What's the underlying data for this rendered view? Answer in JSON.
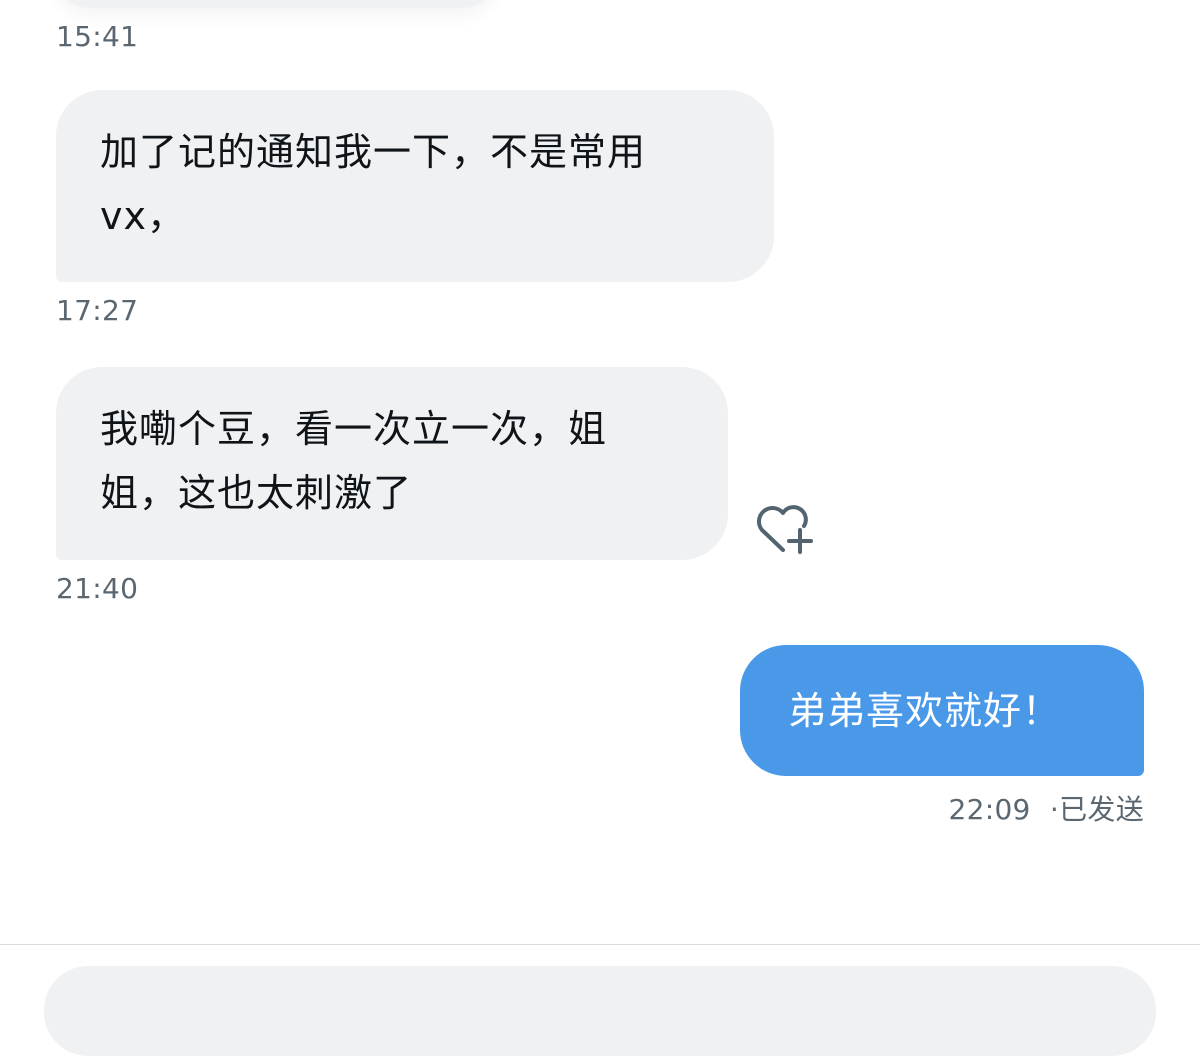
{
  "conversation": {
    "messages": [
      {
        "direction": "incoming",
        "time": "15:41"
      },
      {
        "direction": "incoming",
        "lines": [
          "加了记的通知我一下，不是常用",
          "vx，"
        ],
        "time": "17:27"
      },
      {
        "direction": "incoming",
        "lines": [
          "我嘞个豆，看一次立一次，姐",
          "姐，这也太刺激了"
        ],
        "time": "21:40",
        "reaction_icon": "heart-plus-icon"
      },
      {
        "direction": "outgoing",
        "text": "弟弟喜欢就好！",
        "time": "22:09",
        "status": "·已发送"
      }
    ]
  },
  "colors": {
    "incoming_bubble": "#eff1f3",
    "outgoing_bubble": "#4a99e9",
    "timestamp": "#5b6770",
    "text": "#0f1419"
  }
}
